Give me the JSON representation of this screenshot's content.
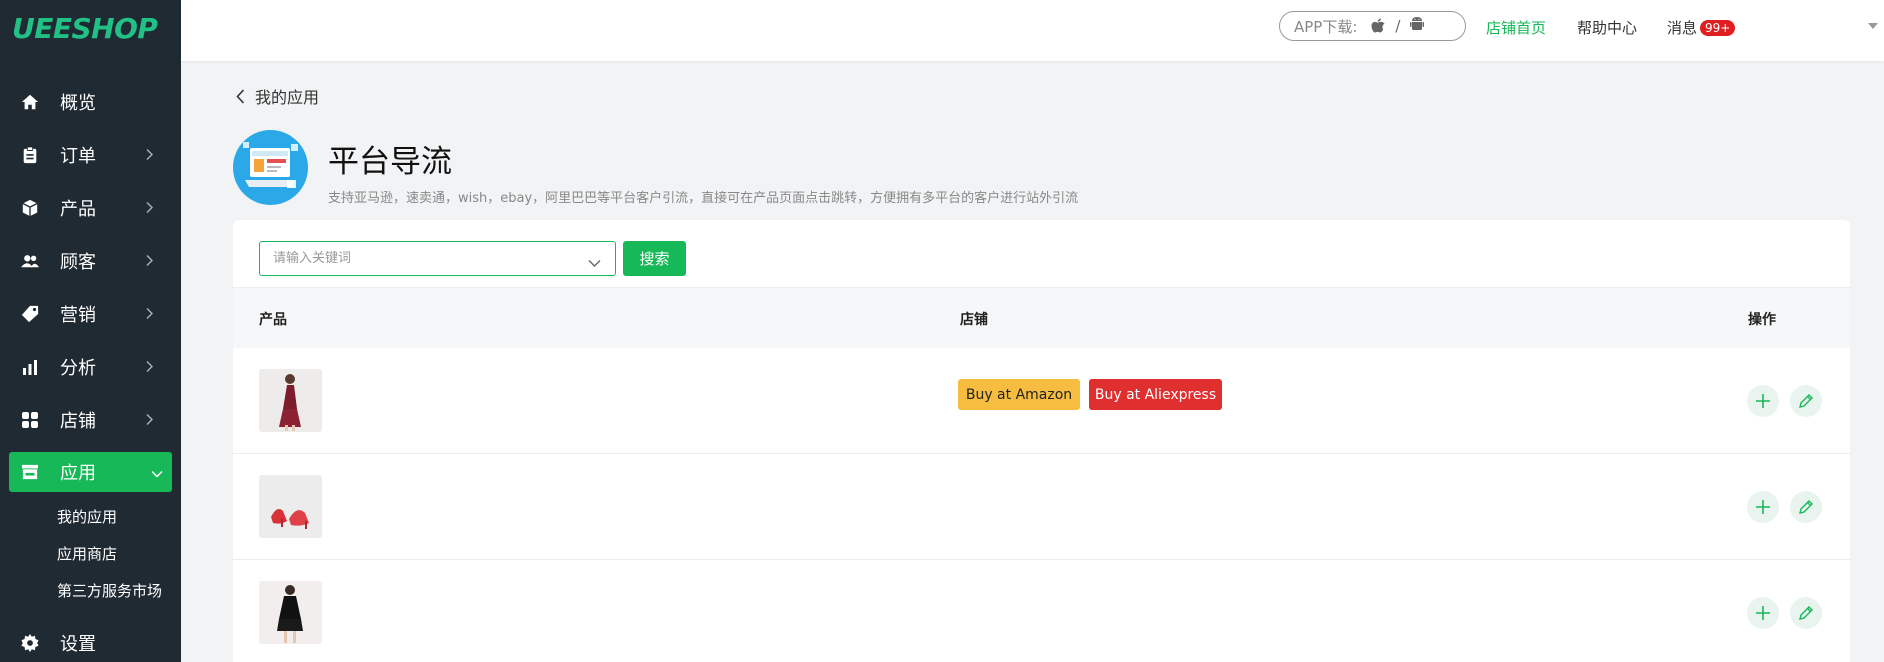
{
  "logo": "UEESHOP",
  "sidebar": {
    "items": [
      {
        "label": "概览",
        "icon": "home-icon"
      },
      {
        "label": "订单",
        "icon": "clipboard-icon"
      },
      {
        "label": "产品",
        "icon": "box-icon"
      },
      {
        "label": "顾客",
        "icon": "users-icon"
      },
      {
        "label": "营销",
        "icon": "tag-icon"
      },
      {
        "label": "分析",
        "icon": "bar-chart-icon"
      },
      {
        "label": "店铺",
        "icon": "grid-icon"
      },
      {
        "label": "应用",
        "icon": "store-icon"
      }
    ],
    "subitems": [
      "我的应用",
      "应用商店",
      "第三方服务市场"
    ],
    "settings_label": "设置"
  },
  "topbar": {
    "app_download_label": "APP下载:",
    "separator": "/",
    "store_home": "店铺首页",
    "help_center": "帮助中心",
    "messages": "消息",
    "messages_badge": "99+"
  },
  "breadcrumb": "我的应用",
  "app": {
    "title": "平台导流",
    "description": "支持亚马逊，速卖通，wish，ebay，阿里巴巴等平台客户引流，直接可在产品页面点击跳转，方便拥有多平台的客户进行站外引流"
  },
  "search": {
    "placeholder": "请输入关键词",
    "button_label": "搜索"
  },
  "table": {
    "headers": [
      "产品",
      "店铺",
      "操作"
    ],
    "rows": [
      {
        "product": "red-dress",
        "buttons": [
          "Buy at Amazon",
          "Buy at Aliexpress"
        ]
      },
      {
        "product": "red-heels",
        "buttons": []
      },
      {
        "product": "black-dress",
        "buttons": []
      }
    ]
  },
  "colors": {
    "accent": "#17b857",
    "sidebar_bg": "#1f2a33",
    "amazon": "#f6bd41",
    "aliexpress": "#e02f2f"
  }
}
